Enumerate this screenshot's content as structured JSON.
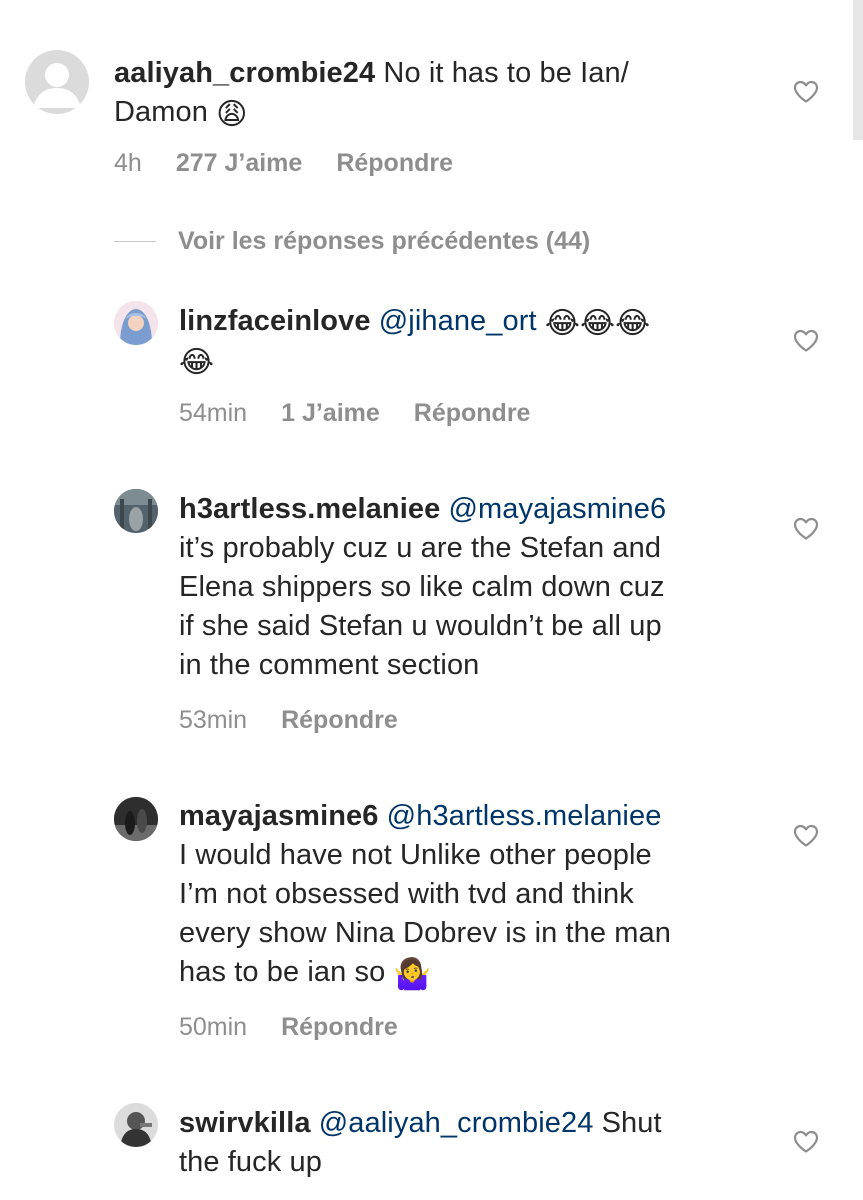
{
  "comments": [
    {
      "username": "aaliyah_crombie24",
      "mention": "",
      "lines": [
        "No it has to be Ian/",
        "Damon"
      ],
      "emoji": "😩",
      "time": "4h",
      "likes": "277 J’aime",
      "reply": "Répondre"
    },
    {
      "username": "linzfaceinlove",
      "mention": "@jihane_ort",
      "emoji_line1": "😂😂😂",
      "emoji_line2": "😂",
      "time": "54min",
      "likes": "1 J’aime",
      "reply": "Répondre"
    },
    {
      "username": "h3artless.melaniee",
      "mention": "@mayajasmine6",
      "lines": [
        "it’s probably cuz u are the Stefan and",
        "Elena shippers so like calm down cuz",
        "if she said Stefan u wouldn’t be all up",
        "in the comment section"
      ],
      "time": "53min",
      "reply": "Répondre"
    },
    {
      "username": "mayajasmine6",
      "mention": "@h3artless.melaniee",
      "lines": [
        "I would have not Unlike other people",
        "I’m not obsessed with tvd and think",
        "every show Nina Dobrev is in the man",
        "has to be ian so"
      ],
      "emoji": "🤷‍♀️",
      "time": "50min",
      "reply": "Répondre"
    },
    {
      "username": "swirvkilla",
      "mention": "@aaliyah_crombie24",
      "line1_rest": "Shut",
      "lines": [
        "the fuck up"
      ]
    }
  ],
  "view_previous": "Voir les réponses précédentes (44)",
  "icons": {
    "like": "heart-outline-icon",
    "avatar_placeholder": "default-user-icon"
  },
  "colors": {
    "text": "#262626",
    "mention": "#003569",
    "meta": "#8e8e8e"
  }
}
